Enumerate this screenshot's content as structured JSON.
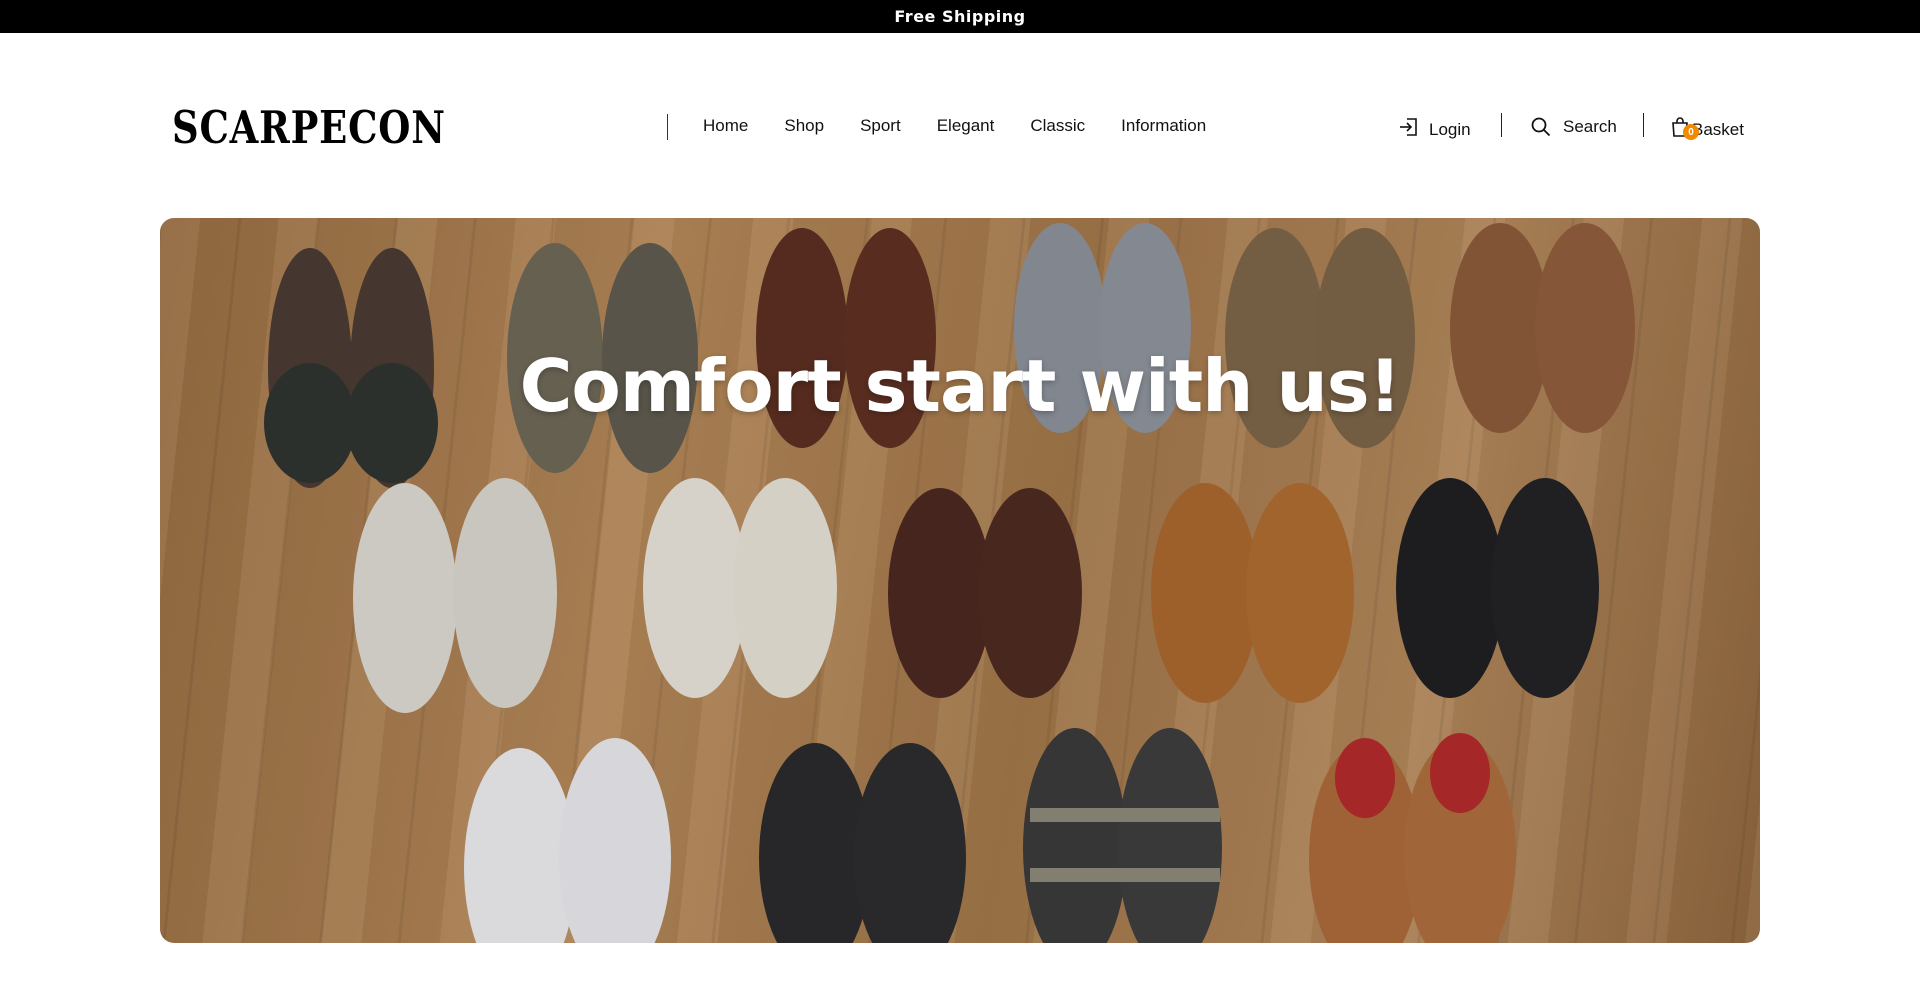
{
  "announcement": {
    "text": "Free Shipping"
  },
  "header": {
    "logo": "SCARPECON",
    "nav": [
      "Home",
      "Shop",
      "Sport",
      "Elegant",
      "Classic",
      "Information"
    ],
    "login_label": "Login",
    "search_label": "Search",
    "basket_label": "Basket",
    "basket_count": "0",
    "icons": {
      "login": "login-icon",
      "search": "search-icon",
      "basket": "shopping-bag-icon"
    },
    "colors": {
      "badge": "#f08a00",
      "announcement_bg": "#000000"
    }
  },
  "hero": {
    "title": "Comfort start with us!",
    "image": "shoes-on-wood-floor-photo"
  }
}
